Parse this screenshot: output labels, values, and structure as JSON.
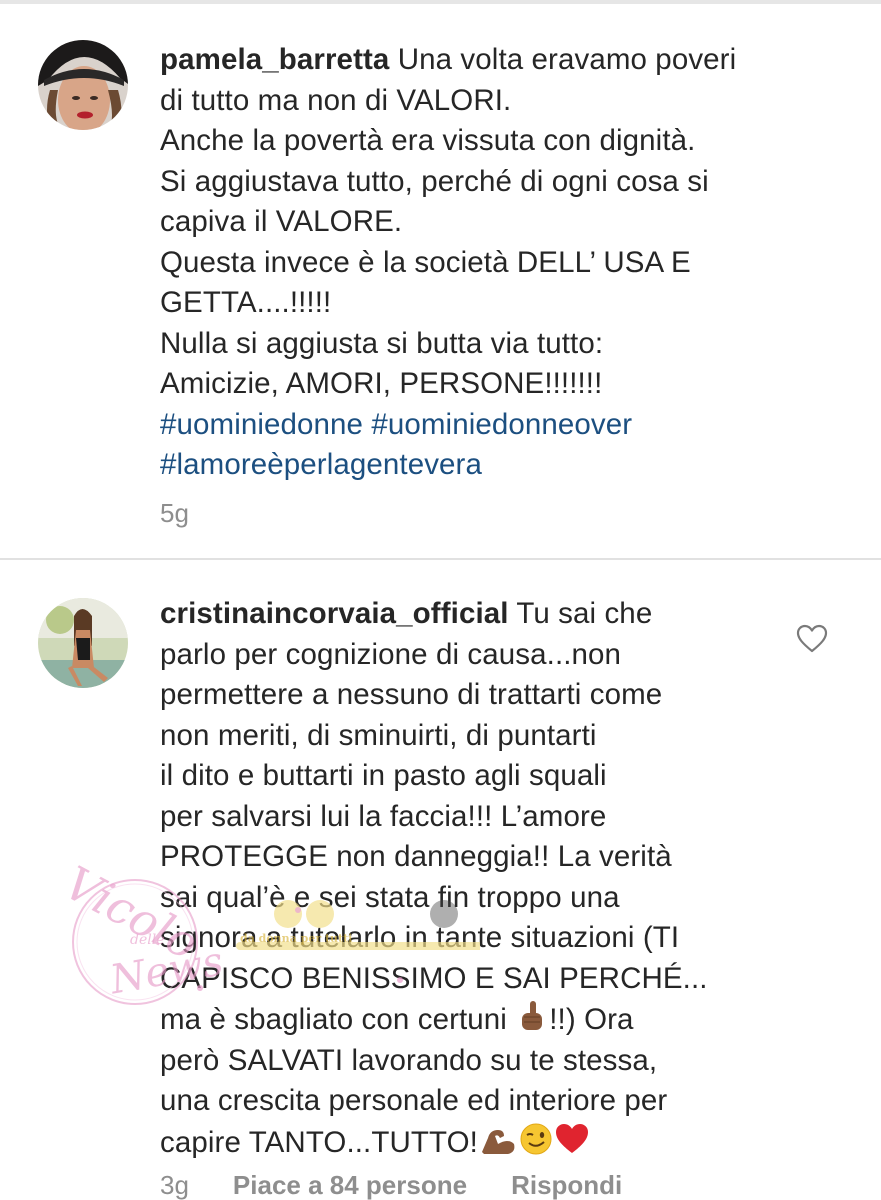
{
  "comments": [
    {
      "username": "pamela_barretta",
      "lines": [
        " Una volta eravamo poveri",
        "di tutto ma non di VALORI.",
        "Anche la povertà era vissuta con dignità.",
        "Si aggiustava tutto, perché di ogni cosa si",
        "capiva il VALORE.",
        "Questa invece è la società DELL’ USA E",
        "GETTA....!!!!!",
        "Nulla si aggiusta si butta via tutto:",
        "Amicizie, AMORI, PERSONE!!!!!!!"
      ],
      "hashtags": [
        "#uominiedonne",
        "#uominiedonneover",
        "#lamoreèperlagentevera"
      ],
      "time": "5g"
    },
    {
      "username": "cristinaincorvaia_official",
      "text_part1": " Tu sai che\nparlo per cognizione di causa...non\npermettere a nessuno di trattarti come\nnon meriti, di sminuirti, di puntarti\nil dito e buttarti in pasto agli squali\nper salvarsi lui la faccia!!! L’amore\nPROTEGGE non danneggia!! La verità\nsai qual’è e sei stata fin troppo una\nsignora a tutelarlo in tante situazioni (TI\nCAPISCO BENISSIMO E SAI PERCHÉ...\nma è sbagliato con certuni ",
      "text_part2": "!!) Ora\nperò SALVATI lavorando su te stessa,\nuna crescita personale ed interiore per\ncapire TANTO...TUTTO!",
      "emojis": [
        "pointing-up-emoji",
        "flexed-biceps-emoji",
        "winking-face-emoji",
        "red-heart-emoji"
      ],
      "time": "3g",
      "likes_label": "Piace a 84 persone",
      "reply_label": "Rispondi"
    }
  ],
  "watermark": {
    "text_main": "Vicolo",
    "text_small": "delle",
    "text_tail": "News",
    "banner": "da donna per tutti"
  },
  "colors": {
    "hashtag": "#1c4f80",
    "meta": "#8e8e8e",
    "heart": "#e0242f",
    "watermark": "#e79bc9"
  }
}
